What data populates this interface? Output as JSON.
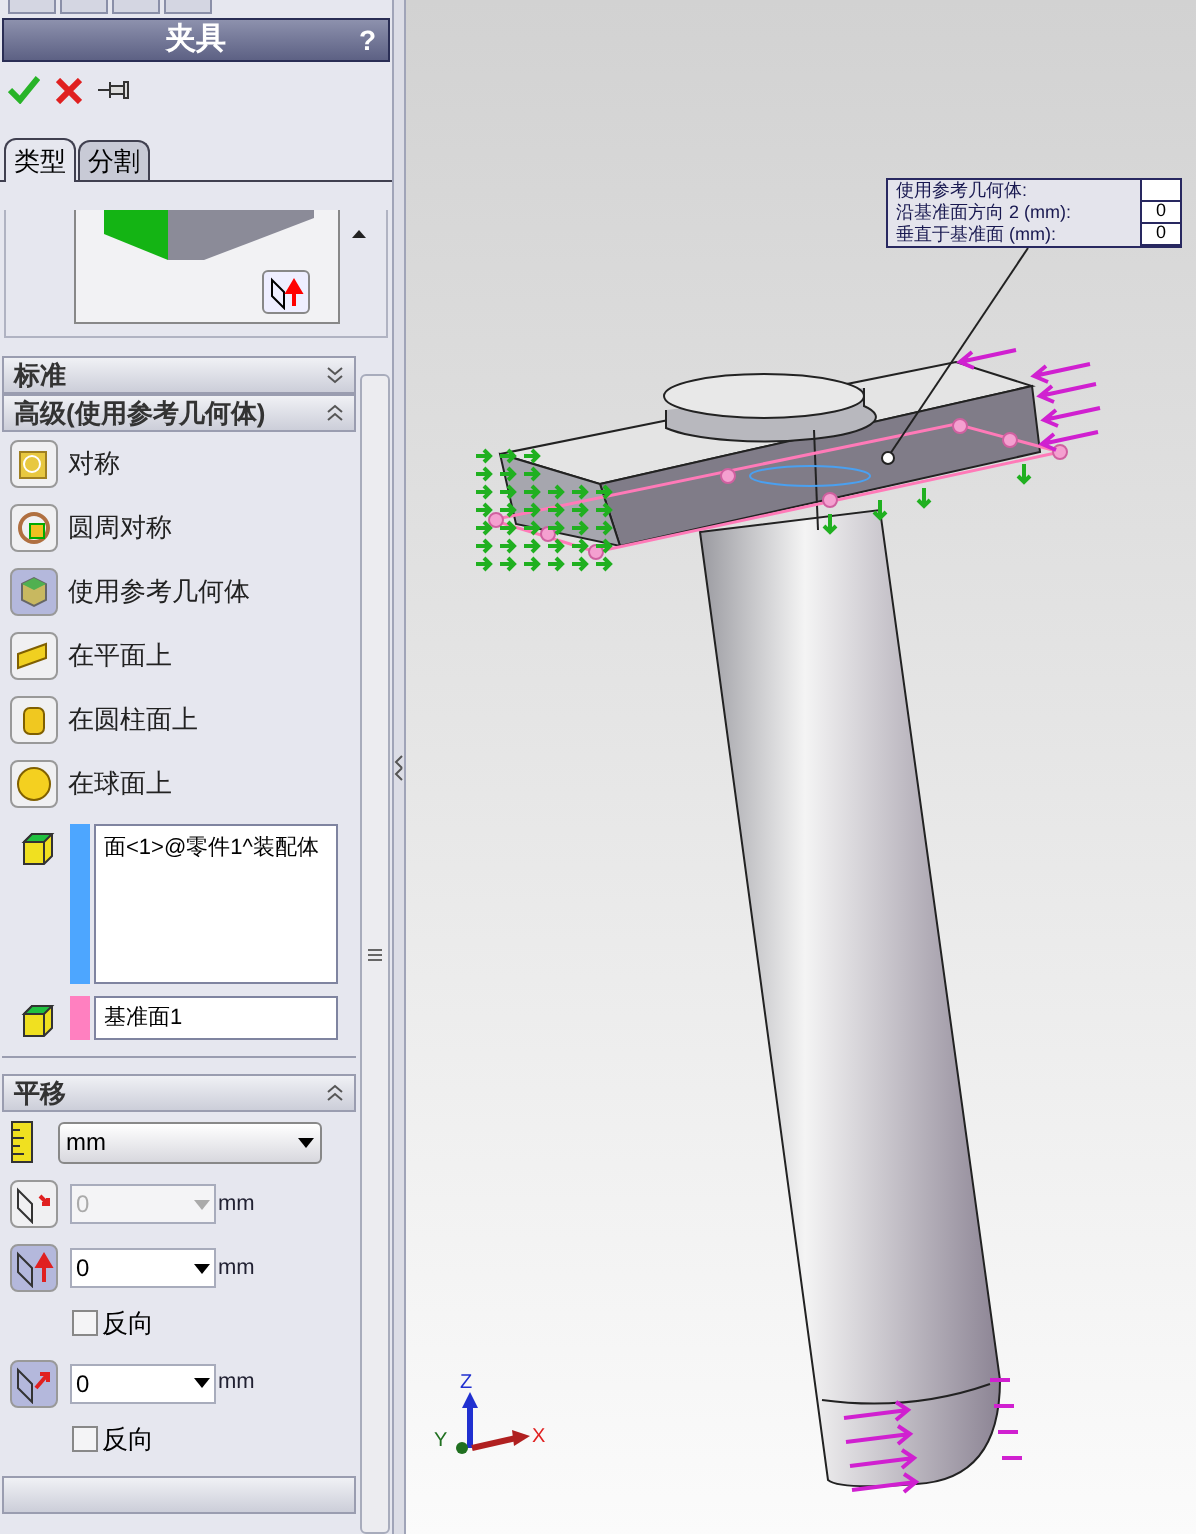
{
  "panel": {
    "title": "夹具",
    "help": "?"
  },
  "tabs": [
    {
      "label": "类型",
      "selected": true
    },
    {
      "label": "分割",
      "selected": false
    }
  ],
  "standard": {
    "title": "标准",
    "expanded": false
  },
  "advanced": {
    "title": "高级(使用参考几何体)",
    "expanded": true,
    "options": [
      {
        "kind": "symmetric",
        "label": "对称",
        "selected": false
      },
      {
        "kind": "circular",
        "label": "圆周对称",
        "selected": false
      },
      {
        "kind": "reference",
        "label": "使用参考几何体",
        "selected": true
      },
      {
        "kind": "plane",
        "label": "在平面上",
        "selected": false
      },
      {
        "kind": "cylinder",
        "label": "在圆柱面上",
        "selected": false
      },
      {
        "kind": "sphere",
        "label": "在球面上",
        "selected": false
      }
    ],
    "selections": [
      {
        "kind": "faces",
        "color": "#4da6ff",
        "items": [
          "面<1>@零件1^装配体"
        ]
      },
      {
        "kind": "plane",
        "color": "#ff80c0",
        "items": [
          "基准面1"
        ]
      }
    ]
  },
  "translation": {
    "title": "平移",
    "expanded": true,
    "units": "mm",
    "fields": [
      {
        "kind": "direction1",
        "value": "0",
        "unit": "mm",
        "disabled": true,
        "selected": false
      },
      {
        "kind": "direction2",
        "value": "0",
        "unit": "mm",
        "disabled": false,
        "selected": true,
        "reverse": {
          "label": "反向",
          "checked": false
        }
      },
      {
        "kind": "normal",
        "value": "0",
        "unit": "mm",
        "disabled": false,
        "selected": true,
        "reverse": {
          "label": "反向",
          "checked": false
        }
      }
    ]
  },
  "callout": {
    "rows": [
      {
        "label": "使用参考几何体:"
      },
      {
        "label": "沿基准面方向 2 (mm):",
        "value": "0"
      },
      {
        "label": "垂直于基准面 (mm):",
        "value": "0"
      }
    ]
  },
  "triad": {
    "z": "Z",
    "x": "X",
    "y": "Y"
  }
}
